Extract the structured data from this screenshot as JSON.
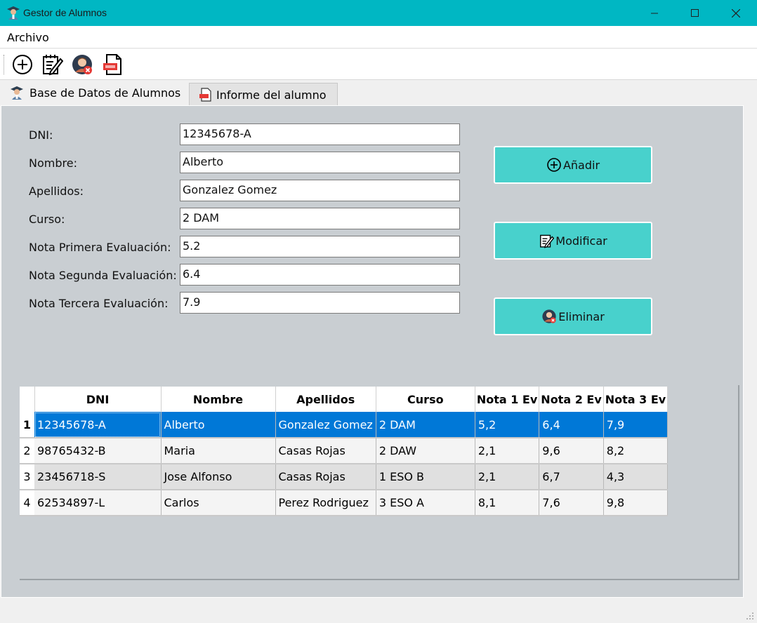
{
  "window": {
    "title": "Gestor de Alumnos"
  },
  "menu": {
    "items": [
      "Archivo"
    ]
  },
  "toolbar": {
    "buttons": [
      "add-icon",
      "edit-icon",
      "delete-user-icon",
      "pdf-report-icon"
    ]
  },
  "tabs": [
    {
      "label": "Base de Datos de Alumnos",
      "icon": "student-icon",
      "active": true
    },
    {
      "label": "Informe del alumno",
      "icon": "pdf-icon",
      "active": false
    }
  ],
  "form": {
    "fields": [
      {
        "label": "DNI:",
        "value": "12345678-A"
      },
      {
        "label": "Nombre:",
        "value": "Alberto"
      },
      {
        "label": "Apellidos:",
        "value": "Gonzalez Gomez"
      },
      {
        "label": "Curso:",
        "value": "2 DAM"
      },
      {
        "label": "Nota Primera Evaluación:",
        "value": "5.2"
      },
      {
        "label": "Nota Segunda Evaluación:",
        "value": "6.4"
      },
      {
        "label": "Nota Tercera Evaluación:",
        "value": "7.9"
      }
    ]
  },
  "buttons": {
    "add": "Añadir",
    "modify": "Modificar",
    "delete": "Eliminar"
  },
  "table": {
    "columns": [
      "DNI",
      "Nombre",
      "Apellidos",
      "Curso",
      "Nota 1 Ev",
      "Nota 2 Ev",
      "Nota 3 Ev"
    ],
    "rows": [
      {
        "num": "1",
        "cells": [
          "12345678-A",
          "Alberto",
          "Gonzalez Gomez",
          "2 DAM",
          "5,2",
          "6,4",
          "7,9"
        ],
        "selected": true
      },
      {
        "num": "2",
        "cells": [
          "98765432-B",
          "Maria",
          "Casas Rojas",
          "2 DAW",
          "2,1",
          "9,6",
          "8,2"
        ]
      },
      {
        "num": "3",
        "cells": [
          "23456718-S",
          "Jose Alfonso",
          "Casas Rojas",
          "1 ESO B",
          "2,1",
          "6,7",
          "4,3"
        ]
      },
      {
        "num": "4",
        "cells": [
          "62534897-L",
          "Carlos",
          "Perez Rodriguez",
          "3 ESO A",
          "8,1",
          "7,6",
          "9,8"
        ]
      }
    ]
  },
  "colors": {
    "titlebar": "#00b7c3",
    "panel": "#c9ced2",
    "action_button": "#48d1cc",
    "selection": "#0078d7"
  }
}
